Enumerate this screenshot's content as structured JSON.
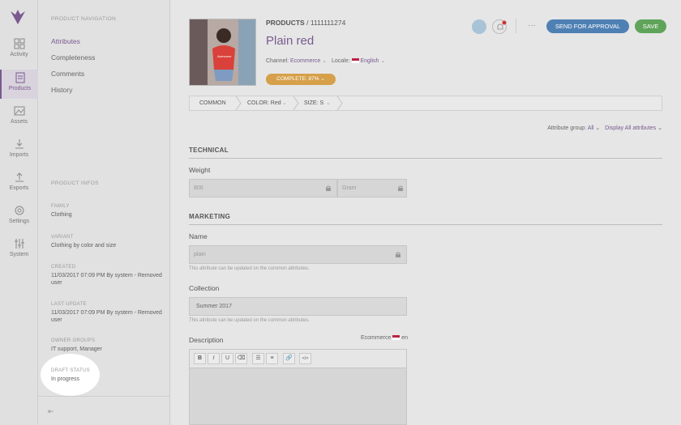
{
  "rail": {
    "items": [
      {
        "label": "Activity",
        "icon": "dashboard-icon"
      },
      {
        "label": "Products",
        "icon": "products-icon"
      },
      {
        "label": "Assets",
        "icon": "assets-icon"
      },
      {
        "label": "Imports",
        "icon": "import-icon"
      },
      {
        "label": "Exports",
        "icon": "export-icon"
      },
      {
        "label": "Settings",
        "icon": "gear-icon"
      },
      {
        "label": "System",
        "icon": "sliders-icon"
      }
    ]
  },
  "nav": {
    "title": "PRODUCT NAVIGATION",
    "links": [
      "Attributes",
      "Completeness",
      "Comments",
      "History"
    ],
    "info_title": "PRODUCT INFOS",
    "infos": [
      {
        "key": "FAMILY",
        "value": "Clothing"
      },
      {
        "key": "VARIANT",
        "value": "Clothing by color and size"
      },
      {
        "key": "CREATED",
        "value": "11/03/2017 07:09 PM By system - Removed user"
      },
      {
        "key": "LAST UPDATE",
        "value": "11/03/2017 07:09 PM By system - Removed user"
      },
      {
        "key": "OWNER GROUPS",
        "value": "IT support, Manager"
      },
      {
        "key": "DRAFT STATUS",
        "value": "In progress"
      }
    ]
  },
  "header": {
    "breadcrumb_prefix": "PRODUCTS",
    "breadcrumb_sep": "/",
    "breadcrumb_id": "1111111274",
    "title": "Plain red",
    "channel_label": "Channel:",
    "channel_value": "Ecommerce",
    "locale_label": "Locale:",
    "locale_value": "English",
    "complete_label": "COMPLETE: 87%",
    "more_label": "···",
    "send_label": "SEND FOR APPROVAL",
    "save_label": "SAVE",
    "thumb_text": "Awesome"
  },
  "axes": [
    "COMMON",
    "COLOR: Red",
    "SIZE: S"
  ],
  "attr_group": {
    "label": "Attribute group:",
    "value": "All",
    "display": "Display All attributes"
  },
  "sections": {
    "technical": "TECHNICAL",
    "marketing": "MARKETING"
  },
  "fields": {
    "weight_label": "Weight",
    "weight_value": "800",
    "weight_unit": "Gram",
    "name_label": "Name",
    "name_value": "plain",
    "name_help": "This attribute can be updated on the common attributes.",
    "collection_label": "Collection",
    "collection_value": "Summer 2017",
    "collection_help": "This attribute can be updated on the common attributes.",
    "description_label": "Description",
    "description_scope": "Ecommerce",
    "description_locale": "en"
  },
  "toolbar": [
    "B",
    "I",
    "U",
    "⌫",
    "☰",
    "≡",
    "🔗",
    "</>"
  ],
  "colors": {
    "accent": "#7a5a8f",
    "complete": "#d6a04a",
    "send": "#4f80b4",
    "save": "#5fa45a"
  }
}
